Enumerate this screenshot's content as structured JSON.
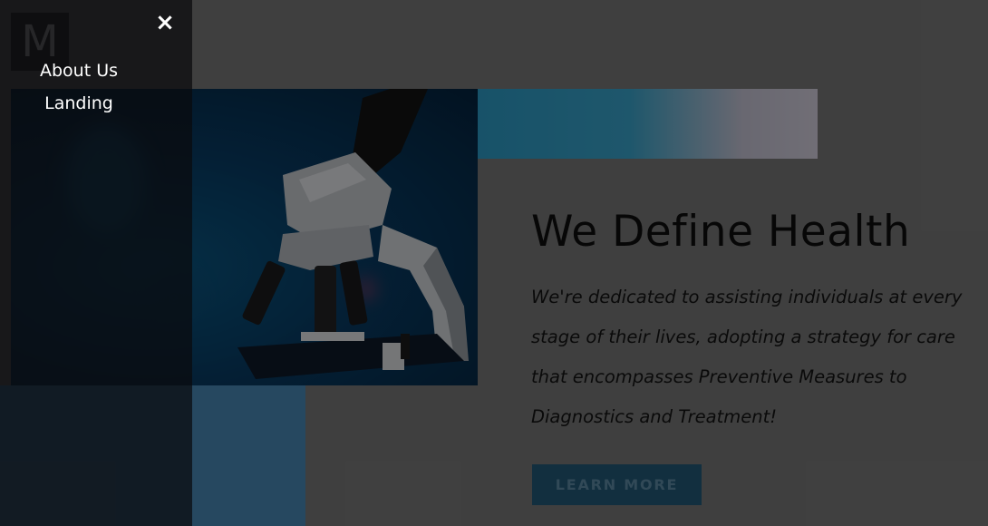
{
  "logo": {
    "letter": "M"
  },
  "drawer": {
    "close_icon": "close-icon",
    "close_glyph": "×",
    "nav_items": [
      {
        "label": "About Us"
      },
      {
        "label": "Landing"
      }
    ]
  },
  "hero": {
    "headline": "We Define Health",
    "description": "We're dedicated to assisting individuals at every stage of their lives, adopting a strategy for care that encompasses Preventive Measures to Diagnostics and Treatment!",
    "cta_label": "LEARN MORE",
    "image_subject": "microscope-image"
  },
  "colors": {
    "accent_blue": "#2a7fb0",
    "button_bg": "#245b7a",
    "overlay": "rgba(0,0,0,0.48)"
  }
}
